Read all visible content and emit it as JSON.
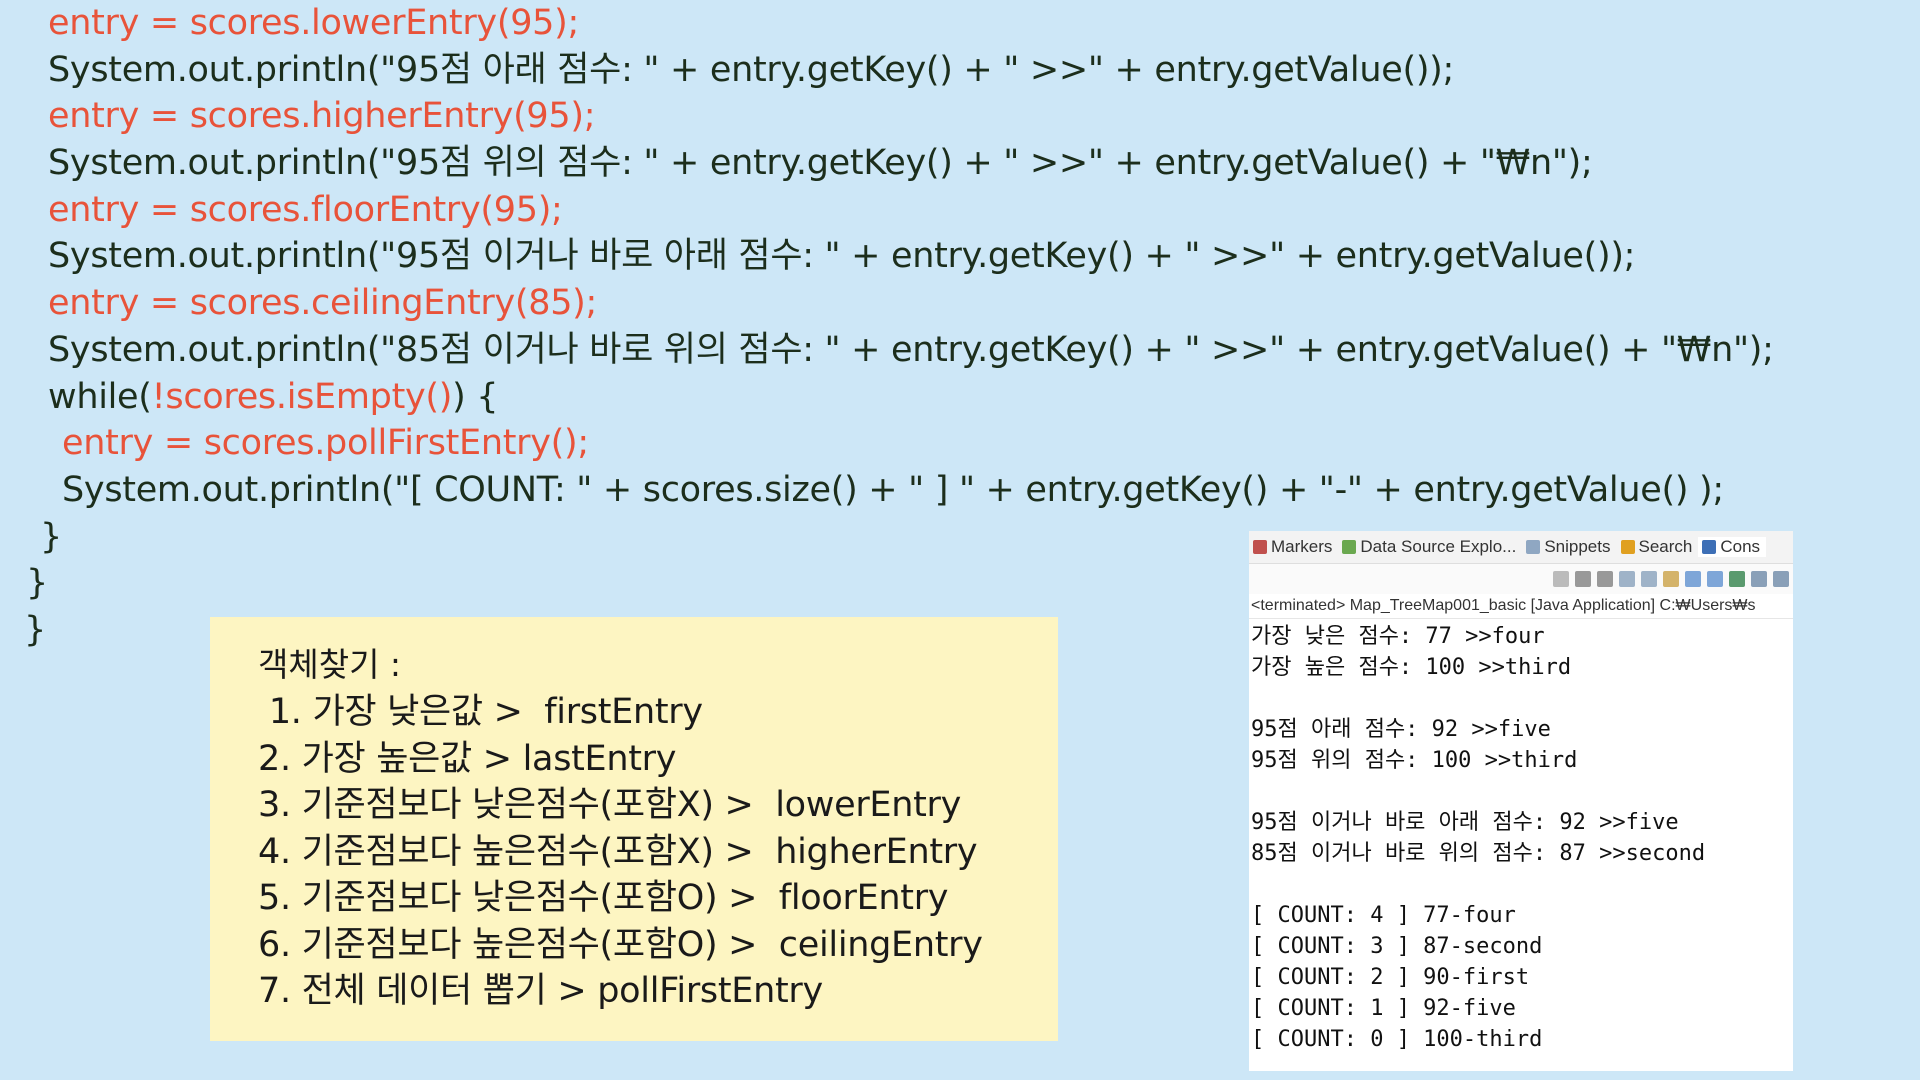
{
  "code": {
    "lines": [
      {
        "text": "entry = scores.lowerEntry(95);",
        "style": "red"
      },
      {
        "text": "System.out.println(\"95점 아래 점수: \" + entry.getKey() + \" >>\" + entry.getValue());",
        "style": "normal"
      },
      {
        "text": "entry = scores.higherEntry(95);",
        "style": "red"
      },
      {
        "text": "System.out.println(\"95점 위의 점수: \" + entry.getKey() + \" >>\" + entry.getValue() + \"₩n\");",
        "style": "normal"
      },
      {
        "text": "entry = scores.floorEntry(95);",
        "style": "red"
      },
      {
        "text": "System.out.println(\"95점 이거나 바로 아래 점수: \" + entry.getKey() + \" >>\" + entry.getValue());",
        "style": "normal"
      },
      {
        "text": "entry = scores.ceilingEntry(85);",
        "style": "red"
      },
      {
        "text": "System.out.println(\"85점 이거나 바로 위의 점수: \" + entry.getKey() + \" >>\" + entry.getValue() + \"₩n\");",
        "style": "normal"
      },
      {
        "text_a": "while(",
        "text_b": "!scores.isEmpty()",
        "text_c": ") {",
        "style": "mixed"
      },
      {
        "text": "entry = scores.pollFirstEntry();",
        "style": "red-indent"
      },
      {
        "text": "System.out.println(\"[ COUNT: \" + scores.size() + \" ] \" + entry.getKey() + \"-\" + entry.getValue() );",
        "style": "indent"
      },
      {
        "text": "}",
        "style": "close1"
      },
      {
        "text": "}",
        "style": "close2"
      },
      {
        "text": "}",
        "style": "close3"
      }
    ]
  },
  "note": {
    "title": "객체찾기 :",
    "items": [
      " 1. 가장 낮은값 >  firstEntry",
      "2. 가장 높은값 > lastEntry",
      "3. 기준점보다 낮은점수(포함X) >  lowerEntry",
      "4. 기준점보다 높은점수(포함X) >  higherEntry",
      "5. 기준점보다 낮은점수(포함O) >  floorEntry",
      "6. 기준점보다 높은점수(포함O) >  ceilingEntry",
      "7. 전체 데이터 뽑기 > pollFirstEntry"
    ]
  },
  "console": {
    "tabs": [
      {
        "label": "Markers",
        "icon": "markers-icon",
        "color": "#c0504d"
      },
      {
        "label": "Data Source Explo...",
        "icon": "data-source-icon",
        "color": "#6aa84f"
      },
      {
        "label": "Snippets",
        "icon": "snippets-icon",
        "color": "#8fa7c2"
      },
      {
        "label": "Search",
        "icon": "search-icon",
        "color": "#e0a020"
      },
      {
        "label": "Cons",
        "icon": "console-icon",
        "color": "#3d6fb6"
      }
    ],
    "status": "<terminated> Map_TreeMap001_basic [Java Application] C:₩Users₩s",
    "output": [
      "가장 낮은 점수: 77 >>four",
      "가장 높은 점수: 100 >>third",
      "",
      "95점 아래 점수: 92 >>five",
      "95점 위의 점수: 100 >>third",
      "",
      "95점 이거나 바로 아래 점수: 92 >>five",
      "85점 이거나 바로 위의 점수: 87 >>second",
      "",
      "[ COUNT: 4 ] 77-four",
      "[ COUNT: 3 ] 87-second",
      "[ COUNT: 2 ] 90-first",
      "[ COUNT: 1 ] 92-five",
      "[ COUNT: 0 ] 100-third"
    ]
  },
  "colors": {
    "background": "#cde7f7",
    "code_red": "#e8533a",
    "code_dark": "#1c2e1c",
    "note_bg": "#fdf5c2"
  }
}
